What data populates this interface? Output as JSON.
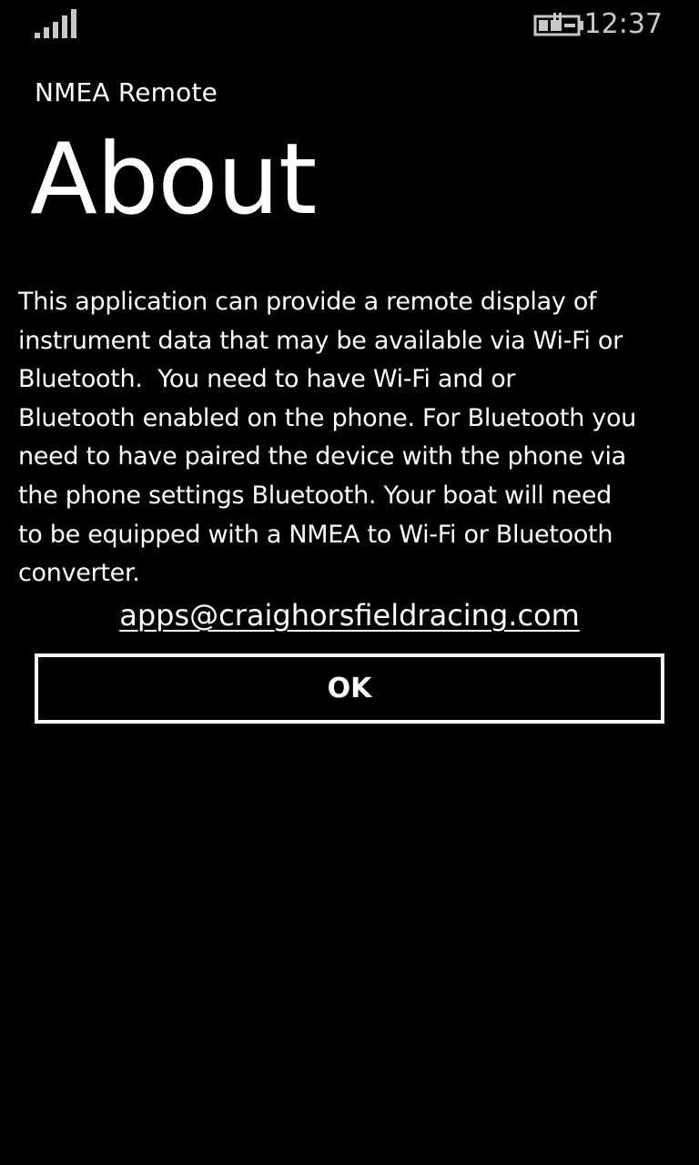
{
  "status_bar": {
    "signal_icon": "cell-signal-icon",
    "battery_icon": "battery-charging-icon",
    "time": "12:37"
  },
  "header": {
    "app_title": "NMEA Remote",
    "page_title": "About"
  },
  "content": {
    "description": "This application can provide a remote display of\ninstrument data that may be available via Wi-Fi or\nBluetooth.  You need to have Wi-Fi and or\nBluetooth enabled on the phone. For Bluetooth you\nneed to have paired the device with the phone via\nthe phone settings Bluetooth. Your boat will need\nto be equipped with a NMEA to Wi-Fi or Bluetooth\nconverter.",
    "email": "apps@craighorsfieldracing.com",
    "ok_label": "OK"
  },
  "colors": {
    "background": "#000000",
    "foreground": "#ffffff",
    "status_text": "#c8c8c8"
  }
}
